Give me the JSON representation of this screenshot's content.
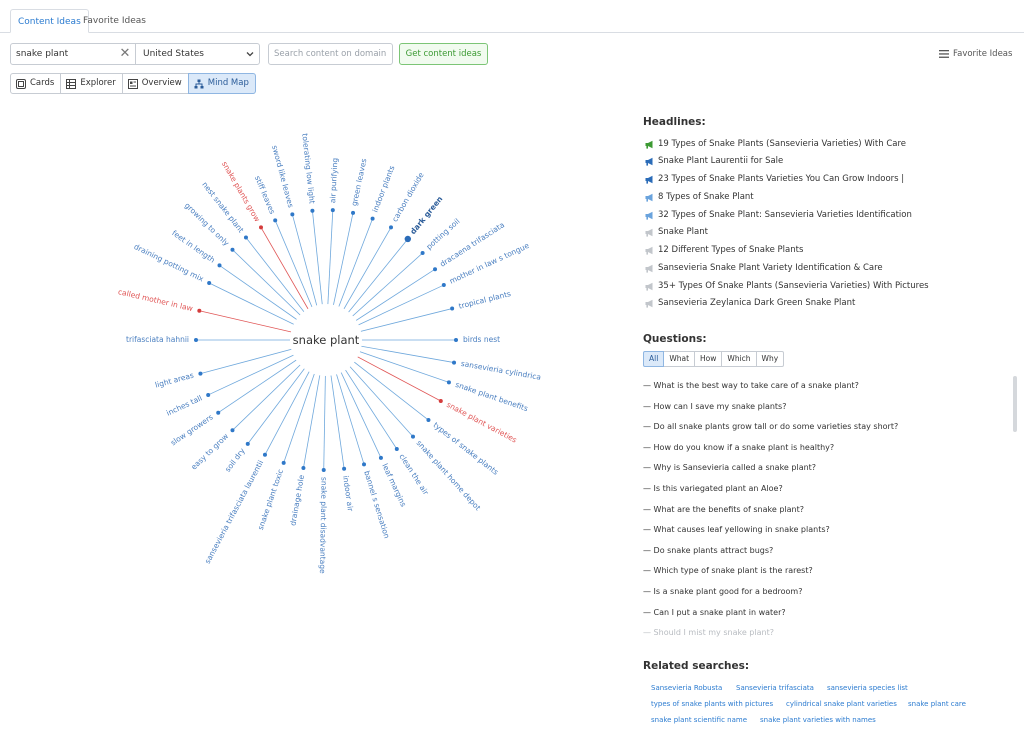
{
  "tabs": {
    "content_ideas": "Content Ideas",
    "favorite_ideas": "Favorite Ideas"
  },
  "search": {
    "keyword": "snake plant",
    "country": "United States",
    "domain_placeholder": "Search content on domain",
    "get_button": "Get content ideas",
    "favorite_link": "Favorite Ideas"
  },
  "views": {
    "cards": "Cards",
    "explorer": "Explorer",
    "overview": "Overview",
    "mindmap": "Mind Map",
    "active": "mindmap"
  },
  "mindmap": {
    "center": "snake plant",
    "colors": {
      "line": "#6fa8dc",
      "label": "#4a7fc0",
      "hot": "#e05555",
      "bold": "#2b5c99"
    },
    "nodes": [
      {
        "label": "birds nest",
        "angle": 0,
        "color": "blue"
      },
      {
        "label": "sansevieria cylindrica",
        "angle": 10,
        "color": "blue"
      },
      {
        "label": "snake plant benefits",
        "angle": 19,
        "color": "blue"
      },
      {
        "label": "snake plant varieties",
        "angle": 28,
        "color": "red"
      },
      {
        "label": "types of snake plants",
        "angle": 38,
        "color": "blue"
      },
      {
        "label": "snake plant home depot",
        "angle": 48,
        "color": "blue"
      },
      {
        "label": "clean the air",
        "angle": 57,
        "color": "blue"
      },
      {
        "label": "leaf margins",
        "angle": 65,
        "color": "blue"
      },
      {
        "label": "bannel s sensation",
        "angle": 73,
        "color": "blue"
      },
      {
        "label": "indoor air",
        "angle": 82,
        "color": "blue"
      },
      {
        "label": "snake plant disadvantage",
        "angle": 91,
        "color": "blue"
      },
      {
        "label": "drainage hole",
        "angle": 100,
        "color": "blue"
      },
      {
        "label": "snake plant toxic",
        "angle": 109,
        "color": "blue"
      },
      {
        "label": "sansevieria trifasciata laurentii",
        "angle": 118,
        "color": "blue"
      },
      {
        "label": "soil dry",
        "angle": 127,
        "color": "blue"
      },
      {
        "label": "easy to grow",
        "angle": 136,
        "color": "blue"
      },
      {
        "label": "slow growers",
        "angle": 146,
        "color": "blue"
      },
      {
        "label": "inches tall",
        "angle": 155,
        "color": "blue"
      },
      {
        "label": "light areas",
        "angle": 165,
        "color": "blue"
      },
      {
        "label": "trifasciata hahnii",
        "angle": 180,
        "color": "blue"
      },
      {
        "label": "called mother in law",
        "angle": 193,
        "color": "red"
      },
      {
        "label": "draining potting mix",
        "angle": 206,
        "color": "blue"
      },
      {
        "label": "feet in length",
        "angle": 215,
        "color": "blue"
      },
      {
        "label": "growing to only",
        "angle": 224,
        "color": "blue"
      },
      {
        "label": "nest snake plant",
        "angle": 232,
        "color": "blue"
      },
      {
        "label": "snake plants grow",
        "angle": 240,
        "color": "red"
      },
      {
        "label": "stiff leaves",
        "angle": 247,
        "color": "blue"
      },
      {
        "label": "sword like leaves",
        "angle": 255,
        "color": "blue"
      },
      {
        "label": "tolerating low light",
        "angle": 264,
        "color": "blue"
      },
      {
        "label": "air purifying",
        "angle": 273,
        "color": "blue"
      },
      {
        "label": "green leaves",
        "angle": 282,
        "color": "blue"
      },
      {
        "label": "indoor plants",
        "angle": 291,
        "color": "blue"
      },
      {
        "label": "carbon dioxide",
        "angle": 300,
        "color": "blue"
      },
      {
        "label": "dark green",
        "angle": 309,
        "color": "bold"
      },
      {
        "label": "potting soil",
        "angle": 318,
        "color": "blue"
      },
      {
        "label": "dracaena trifasciata",
        "angle": 327,
        "color": "blue"
      },
      {
        "label": "mother in law s tongue",
        "angle": 335,
        "color": "blue"
      },
      {
        "label": "tropical plants",
        "angle": 346,
        "color": "blue"
      }
    ]
  },
  "headlines": {
    "title": "Headlines:",
    "items": [
      {
        "text": "19 Types of Snake Plants (Sansevieria Varieties) With Care",
        "icon": "megaphone-green"
      },
      {
        "text": "Snake Plant Laurentii for Sale",
        "icon": "megaphone-blue"
      },
      {
        "text": "23 Types of Snake Plants Varieties You Can Grow Indoors |",
        "icon": "megaphone-blue"
      },
      {
        "text": "8 Types of Snake Plant",
        "icon": "megaphone-lightblue"
      },
      {
        "text": "32 Types of Snake Plant: Sansevieria Varieties Identification",
        "icon": "megaphone-lightblue"
      },
      {
        "text": "Snake Plant",
        "icon": "megaphone-gray"
      },
      {
        "text": "12 Different Types of Snake Plants",
        "icon": "megaphone-gray"
      },
      {
        "text": "Sansevieria Snake Plant Variety Identification & Care",
        "icon": "megaphone-gray"
      },
      {
        "text": "35+ Types Of Snake Plants (Sansevieria Varieties) With Pictures",
        "icon": "megaphone-gray"
      },
      {
        "text": "Sansevieria Zeylanica Dark Green Snake Plant",
        "icon": "megaphone-gray"
      }
    ],
    "icon_colors": {
      "megaphone-green": "#3c9a33",
      "megaphone-blue": "#2b6cb8",
      "megaphone-lightblue": "#6aa3dd",
      "megaphone-gray": "#c2c6cb"
    }
  },
  "questions": {
    "title": "Questions:",
    "filters": [
      "All",
      "What",
      "How",
      "Which",
      "Why"
    ],
    "active_filter": "All",
    "items": [
      "— What is the best way to take care of a snake plant?",
      "— How can I save my snake plants?",
      "— Do all snake plants grow tall or do some varieties stay short?",
      "— How do you know if a snake plant is healthy?",
      "— Why is Sansevieria called a snake plant?",
      "— Is this variegated plant an Aloe?",
      "— What are the benefits of snake plant?",
      "— What causes leaf yellowing in snake plants?",
      "— Do snake plants attract bugs?",
      "— Which type of snake plant is the rarest?",
      "— Is a snake plant good for a bedroom?",
      "— Can I put a snake plant in water?",
      "— Should I mist my snake plant?"
    ]
  },
  "related": {
    "title": "Related searches:",
    "items": [
      "Sansevieria Robusta",
      "Sansevieria trifasciata",
      "sansevieria species list",
      "types of snake plants with pictures",
      "cylindrical snake plant varieties",
      "snake plant care",
      "snake plant scientific name",
      "snake plant varieties with names"
    ]
  }
}
